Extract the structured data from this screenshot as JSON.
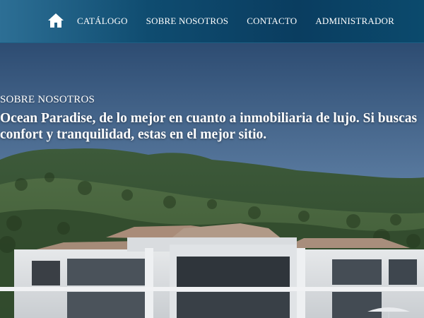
{
  "nav": {
    "home_icon": "home-icon",
    "items": [
      {
        "label": "CATÁLOGO"
      },
      {
        "label": "SOBRE NOSOTROS"
      },
      {
        "label": "CONTACTO"
      },
      {
        "label": "ADMINISTRADOR"
      }
    ]
  },
  "hero": {
    "eyebrow": "SOBRE NOSOTROS",
    "headline": "Ocean Paradise, de lo mejor en cuanto a inmobiliaria de lujo. Si buscas confort y tranquilidad, estas en el mejor sitio."
  },
  "colors": {
    "nav_start": "#2d6f95",
    "nav_end": "#0a3d60",
    "text": "#ffffff"
  }
}
